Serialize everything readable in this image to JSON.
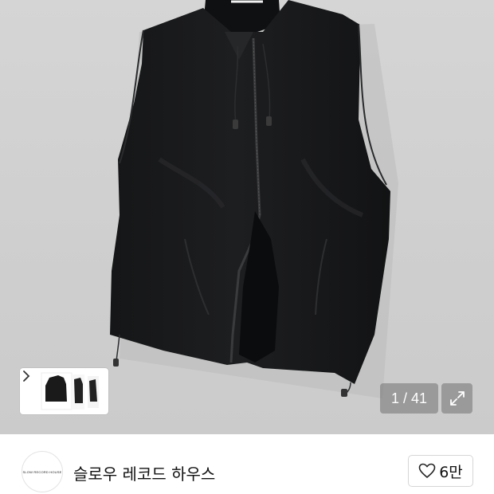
{
  "gallery": {
    "product_image_alt": "",
    "current_page": "1 / 41",
    "thumbnails": [
      "vest-front-thumb",
      "vest-side-thumb",
      "vest-back-thumb"
    ],
    "thumbnail_next_icon": "chevron-right-icon",
    "expand_icon": "expand-arrows-icon"
  },
  "store": {
    "logo_text": "SLOW RECORD HOUSE",
    "name": "슬로우 레코드 하우스",
    "like_icon": "heart-outline-icon",
    "like_count": "6만"
  }
}
